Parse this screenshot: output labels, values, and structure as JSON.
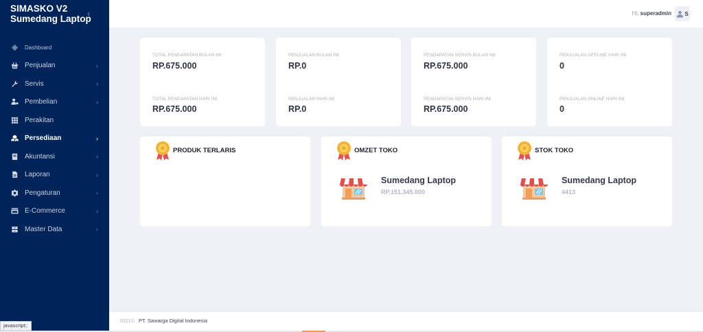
{
  "app": {
    "name_line1": "SIMASKO V2",
    "name_line2": "Sumedang Laptop",
    "collapse_glyph": "‹"
  },
  "sidebar": {
    "items": [
      {
        "label": "Dashboard",
        "icon": "diamond-icon",
        "has_children": false
      },
      {
        "label": "Penjualan",
        "icon": "basket-icon",
        "has_children": true
      },
      {
        "label": "Servis",
        "icon": "wrench-icon",
        "has_children": true
      },
      {
        "label": "Pembelian",
        "icon": "user-cart-icon",
        "has_children": true
      },
      {
        "label": "Perakitan",
        "icon": "grid-icon",
        "has_children": false
      },
      {
        "label": "Persediaan",
        "icon": "boxes-icon",
        "has_children": true,
        "active": true
      },
      {
        "label": "Akuntansi",
        "icon": "book-icon",
        "has_children": true
      },
      {
        "label": "Laporan",
        "icon": "file-icon",
        "has_children": true
      },
      {
        "label": "Pengaturan",
        "icon": "gear-icon",
        "has_children": true
      },
      {
        "label": "E-Commerce",
        "icon": "store-icon",
        "has_children": true
      },
      {
        "label": "Master Data",
        "icon": "archive-icon",
        "has_children": true
      }
    ],
    "chevron": "›"
  },
  "header": {
    "greeting_prefix": "Hi, ",
    "username": "superadmin",
    "avatar_letter": "S"
  },
  "stats": [
    {
      "label_top": "TOTAL PENDAPATAN BULAN INI",
      "value_top": "RP.675.000",
      "label_bottom": "TOTAL PENDAPATAN HARI INI",
      "value_bottom": "RP.675.000"
    },
    {
      "label_top": "PENJUALAN BULAN INI",
      "value_top": "RP.0",
      "label_bottom": "PENJUALAN HARI INI",
      "value_bottom": "RP.0"
    },
    {
      "label_top": "PENDAPATAN SERVIS BULAN INI",
      "value_top": "RP.675.000",
      "label_bottom": "PENDAPATAN SERVIS HARI INI",
      "value_bottom": "RP.675.000"
    },
    {
      "label_top": "PENJUALAN OFFLINE HARI INI",
      "value_top": "0",
      "label_bottom": "PENJUALAN ONLINE HARI INI",
      "value_bottom": "0"
    }
  ],
  "panels": {
    "produk": {
      "title": "PRODUK TERLARIS"
    },
    "omzet": {
      "title": "OMZET TOKO",
      "store_name": "Sumedang Laptop",
      "store_value": "RP.151.345.000"
    },
    "stok": {
      "title": "STOK TOKO",
      "store_name": "Sumedang Laptop",
      "store_value": "4413"
    }
  },
  "footer": {
    "year": "2021©",
    "company": "PT. Sawarga Digital Indonesia"
  },
  "status_bar": {
    "text": "javascript:;"
  },
  "colors": {
    "sidebar_bg": "#00245a",
    "page_bg": "#f0f1f7",
    "card_bg": "#ffffff",
    "accent_orange": "#f39c54"
  }
}
